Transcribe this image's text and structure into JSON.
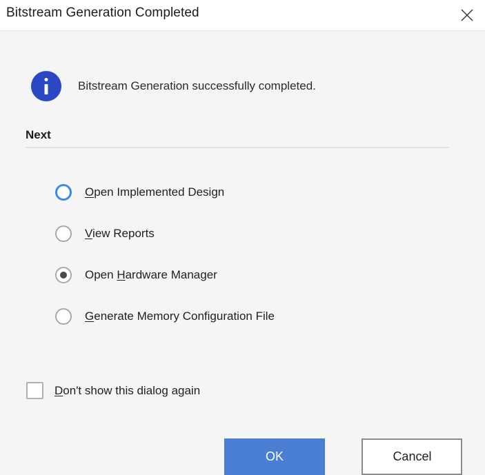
{
  "window": {
    "title": "Bitstream Generation Completed",
    "close_icon": "close-icon",
    "close_label": "Close"
  },
  "message": {
    "icon": "info-icon",
    "text": "Bitstream Generation successfully completed."
  },
  "section": {
    "heading": "Next"
  },
  "radios": [
    {
      "mnemonic": "O",
      "rest": "pen Implemented Design",
      "full_label": "Open Implemented Design",
      "checked": false,
      "hover": true,
      "name": "radio-open-implemented-design"
    },
    {
      "mnemonic": "V",
      "rest": "iew Reports",
      "full_label": "View Reports",
      "checked": false,
      "hover": false,
      "name": "radio-view-reports"
    },
    {
      "prefix": "Open ",
      "mnemonic": "H",
      "rest": "ardware Manager",
      "full_label": "Open Hardware Manager",
      "checked": true,
      "hover": false,
      "name": "radio-open-hardware-manager"
    },
    {
      "mnemonic": "G",
      "rest": "enerate Memory Configuration File",
      "full_label": "Generate Memory Configuration File",
      "checked": false,
      "hover": false,
      "name": "radio-generate-memory-configuration-file"
    }
  ],
  "checkbox": {
    "mnemonic": "D",
    "rest": "on't show this dialog again",
    "full_label": "Don't show this dialog again",
    "checked": false
  },
  "buttons": {
    "ok": "OK",
    "cancel": "Cancel"
  },
  "colors": {
    "accent_blue": "#4a7ed3",
    "info_blue": "#2c47c4",
    "hover_ring": "#3d8ae2",
    "window_bg": "#f5f5f5",
    "titlebar_bg": "#ffffff"
  }
}
